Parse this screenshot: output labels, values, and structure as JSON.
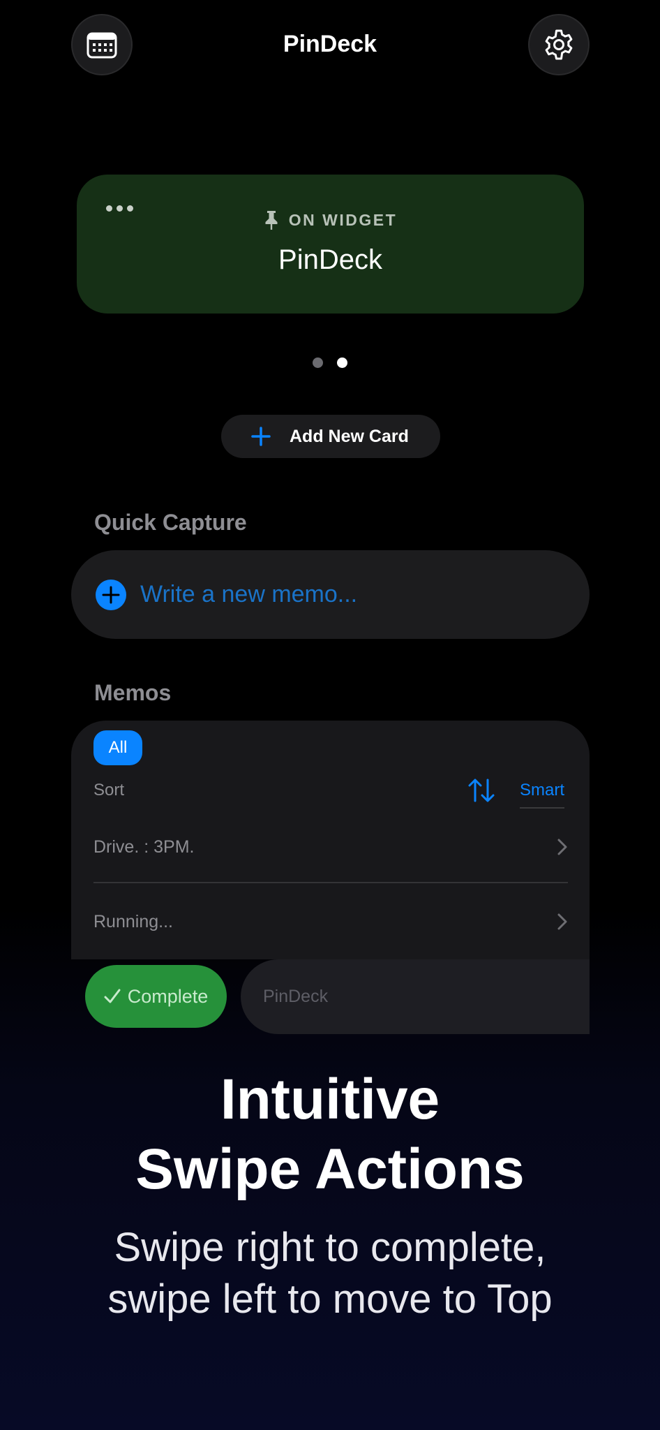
{
  "header": {
    "title": "PinDeck",
    "left_icon": "calendar-icon",
    "right_icon": "gear-icon"
  },
  "widget_card": {
    "badge": "ON WIDGET",
    "name": "PinDeck",
    "menu_icon": "ellipsis-icon",
    "badge_icon": "pin-icon",
    "color": "#163016"
  },
  "pager": {
    "count": 2,
    "active_index": 1
  },
  "add_card": {
    "label": "Add New Card",
    "icon": "plus-icon"
  },
  "quick_capture": {
    "heading": "Quick Capture",
    "placeholder": "Write a new memo...",
    "icon": "plus-circle-icon"
  },
  "memos": {
    "heading": "Memos",
    "filter": "All",
    "sort_label": "Sort",
    "sort_mode": "Smart",
    "sort_icon": "sort-arrows-icon",
    "items": [
      {
        "text": "Drive. : 3PM."
      },
      {
        "text": "Running..."
      }
    ]
  },
  "swipe_demo": {
    "complete_label": "Complete",
    "row_text": "PinDeck",
    "complete_color": "#26913a"
  },
  "marketing": {
    "headline_line1": "Intuitive",
    "headline_line2": "Swipe Actions",
    "sub_line1": "Swipe right to complete,",
    "sub_line2": "swipe left to move to Top"
  },
  "colors": {
    "accent": "#0a84ff",
    "background": "#000000"
  }
}
